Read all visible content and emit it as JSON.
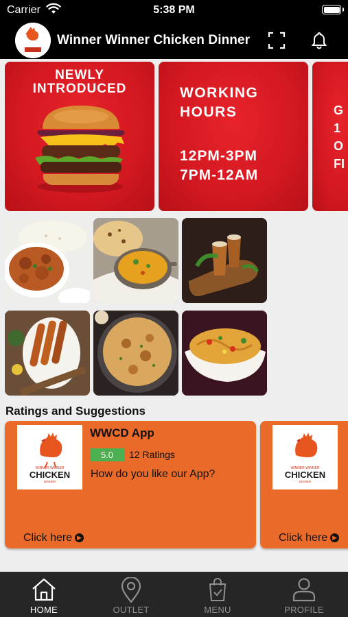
{
  "status": {
    "carrier": "Carrier",
    "time": "5:38 PM"
  },
  "header": {
    "title": "Winner Winner Chicken Dinner",
    "logo_alt": "wwcd-logo"
  },
  "banners": [
    {
      "text": "NEWLY\nINTRODUCED"
    },
    {
      "line1": "WORKING\nHOURS",
      "line2": "12PM-3PM\n7PM-12AM"
    },
    {
      "text": "G\n1\nO\nFI"
    }
  ],
  "food_tiles": [
    "chicken-curry",
    "naan-and-dal",
    "lassi-drinks",
    "seekh-kebab",
    "biryani",
    "hakka-noodles"
  ],
  "ratings": {
    "section_title": "Ratings and Suggestions",
    "cards": [
      {
        "logo_text": "CHICKEN",
        "logo_top": "WINNER WINNER",
        "logo_bottom": "DINNER",
        "title": "WWCD App",
        "score": "5.0",
        "count": "12 Ratings",
        "question": "How do you like our App?",
        "cta": "Click here"
      },
      {
        "logo_text": "CHICKEN",
        "logo_top": "WINNER WINNER",
        "logo_bottom": "DINNER",
        "cta": "Click here"
      }
    ]
  },
  "tabs": [
    {
      "label": "HOME",
      "icon": "home-icon",
      "active": true
    },
    {
      "label": "OUTLET",
      "icon": "location-pin-icon",
      "active": false
    },
    {
      "label": "MENU",
      "icon": "shopping-bag-icon",
      "active": false
    },
    {
      "label": "PROFILE",
      "icon": "person-icon",
      "active": false
    }
  ],
  "colors": {
    "brand_red": "#d21820",
    "card_orange": "#ea6a2a",
    "rating_green": "#4caf50",
    "tabbar": "#262626"
  }
}
